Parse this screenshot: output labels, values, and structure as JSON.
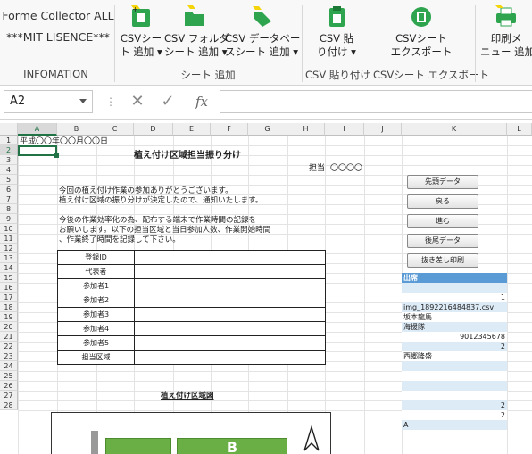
{
  "ribbon": {
    "info_line1": "Forme Collector ALL",
    "info_line2": "***MIT LISENCE***",
    "info_group": "INFOMATION",
    "btn_csv_sheet_add": [
      "CSVシー",
      "ト 追加"
    ],
    "btn_csv_folder_add": [
      "CSV フォルダ",
      "シート 追加"
    ],
    "btn_csv_db_add": [
      "CSV データベー",
      "スシート 追加"
    ],
    "grp_sheet_add": "シート 追加",
    "btn_csv_paste": [
      "CSV 貼",
      "り付け"
    ],
    "grp_csv_paste": "CSV 貼り付け",
    "btn_csv_export": [
      "CSVシート",
      "エクスポート"
    ],
    "grp_csv_export": "CSVシート エクスポート",
    "btn_print_menu_add": [
      "印刷メ",
      "ニュー 追加"
    ],
    "icon_color": "#2ea44f"
  },
  "formula_bar": {
    "name_box": "A2",
    "fx_label": "fx",
    "formula": ""
  },
  "columns": [
    "A",
    "B",
    "C",
    "D",
    "E",
    "F",
    "G",
    "H",
    "I",
    "J",
    "K",
    "L"
  ],
  "rows": [
    "1",
    "2",
    "3",
    "4",
    "5",
    "6",
    "7",
    "8",
    "9",
    "10",
    "11",
    "12",
    "13",
    "14",
    "15",
    "16",
    "17",
    "18",
    "19",
    "20",
    "21",
    "22",
    "23",
    "24",
    "25",
    "26",
    "27",
    "28"
  ],
  "sheet": {
    "date": "平成〇〇年〇〇月〇〇日",
    "title": "植え付け区域担当振り分け",
    "tanto_label": "担当",
    "tanto_value": "〇〇〇〇",
    "para1_line1": "今回の植え付け作業の参加ありがとうございます。",
    "para1_line2": "植え付け区域の振り分けが決定したので、通知いたします。",
    "para2_line1": "今後の作業効率化の為、配布する端末で作業時間の記録を",
    "para2_line2": "お願いします。以下の担当区域と当日参加人数、作業開始時間",
    "para2_line3": "、作業終了時間を記録して下さい。",
    "table_labels": [
      "登録ID",
      "代表者",
      "参加者1",
      "参加者2",
      "参加者3",
      "参加者4",
      "参加者5",
      "担当区域"
    ],
    "map_title": "植え付け区域図",
    "map_label_b": "B"
  },
  "side_buttons": [
    "先頭データ",
    "戻る",
    "進む",
    "後尾データ",
    "抜き差し印刷"
  ],
  "k_column": {
    "header": "出席",
    "values": [
      "",
      "1",
      "img_1892216484837.csv",
      "坂本龍馬",
      "海援隊",
      "9012345678",
      "2",
      "西郷隆盛",
      "",
      "",
      "",
      "",
      "2",
      "2",
      "A"
    ]
  }
}
